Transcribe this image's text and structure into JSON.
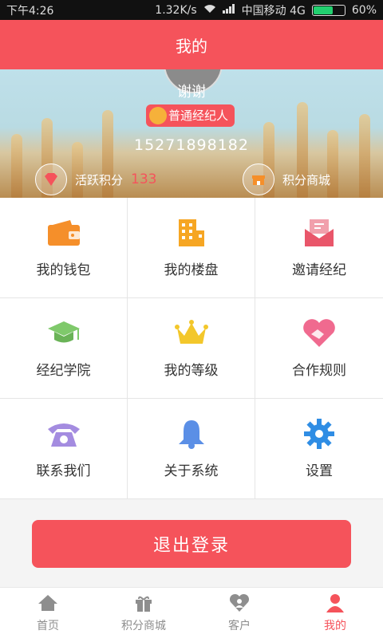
{
  "status_bar": {
    "time": "下午4:26",
    "speed": "1.32K/s",
    "carrier": "中国移动 4G",
    "battery": "60%",
    "battery_level": 0.6
  },
  "header": {
    "title": "我的"
  },
  "profile": {
    "name": "谢谢",
    "badge": "普通经纪人",
    "phone": "15271898182",
    "points_label": "活跃积分",
    "points_value": "133",
    "mall_label": "积分商城"
  },
  "menu": [
    {
      "label": "我的钱包",
      "icon": "wallet-icon",
      "color": "#f58f2a"
    },
    {
      "label": "我的楼盘",
      "icon": "building-icon",
      "color": "#f6a623"
    },
    {
      "label": "邀请经纪",
      "icon": "invite-mail-icon",
      "color": "#e9566a"
    },
    {
      "label": "经纪学院",
      "icon": "graduation-cap-icon",
      "color": "#7fc96b"
    },
    {
      "label": "我的等级",
      "icon": "crown-icon",
      "color": "#f3c72b"
    },
    {
      "label": "合作规则",
      "icon": "handshake-heart-icon",
      "color": "#f06a8f"
    },
    {
      "label": "联系我们",
      "icon": "telephone-icon",
      "color": "#a48ce0"
    },
    {
      "label": "关于系统",
      "icon": "bell-icon",
      "color": "#5b8fe6"
    },
    {
      "label": "设置",
      "icon": "gear-icon",
      "color": "#2f8de4"
    }
  ],
  "logout_label": "退出登录",
  "tabs": [
    {
      "label": "首页",
      "icon": "home-icon"
    },
    {
      "label": "积分商城",
      "icon": "gift-icon"
    },
    {
      "label": "客户",
      "icon": "customer-heart-icon"
    },
    {
      "label": "我的",
      "icon": "person-icon"
    }
  ]
}
